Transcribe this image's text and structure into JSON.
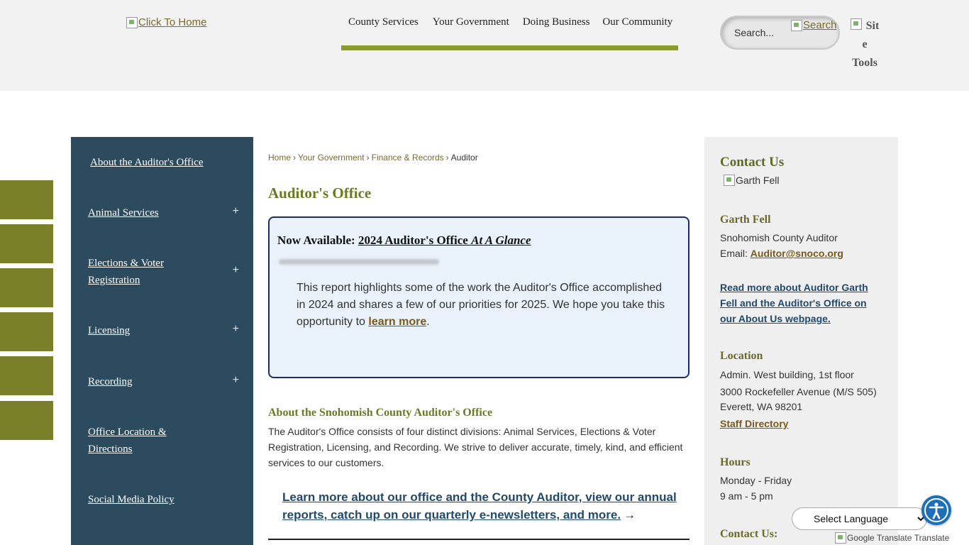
{
  "header": {
    "logo_alt": "Click To Home",
    "nav": [
      "County Services",
      "Your Government",
      "Doing Business",
      "Our Community"
    ],
    "nav_accent": "#8a9a2e",
    "search_placeholder": "Search...",
    "search_button": "Search",
    "site_tools_alt": "Site Tools"
  },
  "sidebar": {
    "bg_color": "#2d4b5e",
    "items": [
      {
        "label": "About the Auditor's Office",
        "expand": ""
      },
      {
        "label": "Animal Services",
        "expand": "+"
      },
      {
        "label": "Elections & Voter Registration",
        "expand": "+"
      },
      {
        "label": "Licensing",
        "expand": "+"
      },
      {
        "label": "Recording",
        "expand": "+"
      },
      {
        "label": "Office Location & Directions",
        "expand": ""
      },
      {
        "label": "Social Media Policy",
        "expand": ""
      }
    ]
  },
  "breadcrumb": [
    {
      "label": "Home"
    },
    {
      "label": "Your Government"
    },
    {
      "label": "Finance & Records"
    },
    {
      "label": "Auditor"
    }
  ],
  "breadcrumb_separator": "›",
  "main": {
    "title": "Auditor's Office",
    "callout": {
      "prefix": "Now Available: ",
      "link_text": "2024 Auditor's Office ",
      "link_italic": "At A Glance",
      "body": "This report highlights some of the work the Auditor's Office accomplished in 2024 and shares a few of our priorities for 2025. We hope you take this opportunity to ",
      "body_link": "learn more",
      "body_end": "."
    },
    "about_heading": "About the Snohomish County Auditor's Office",
    "about_text": "The Auditor's Office consists of four distinct divisions: Animal Services, Elections & Voter Registration, Licensing, and Recording. We strive to deliver accurate, timely, kind, and efficient services to our customers.",
    "cta_text": "Learn more about our office and the County Auditor, view our annual reports, catch up on our quarterly e-newsletters, and more.",
    "cta_arrow": "→"
  },
  "contact": {
    "heading": "Contact Us",
    "photo_alt": "Garth Fell",
    "name": "Garth Fell",
    "role": "Snohomish County Auditor",
    "email_label": "Email: ",
    "email": "Auditor@snoco.org",
    "read_more": "Read more about Auditor Garth Fell and the Auditor's Office on our About Us webpage.",
    "location_heading": "Location",
    "location_lines": [
      "Admin. West building, 1st floor",
      "3000 Rockefeller Avenue (M/S 505)",
      "Everett, WA 98201"
    ],
    "staff_directory": "Staff Directory",
    "hours_heading": "Hours",
    "hours_lines": [
      "Monday - Friday",
      "9 am - 5 pm"
    ],
    "contact_us_heading": "Contact Us:"
  },
  "translate": {
    "select_label": "Select Language",
    "attribution_alt": "Google Translate",
    "attribution_text": "Translate"
  },
  "accessibility_icon": "accessibility-icon",
  "side_tab_color": "#7a7f2a"
}
